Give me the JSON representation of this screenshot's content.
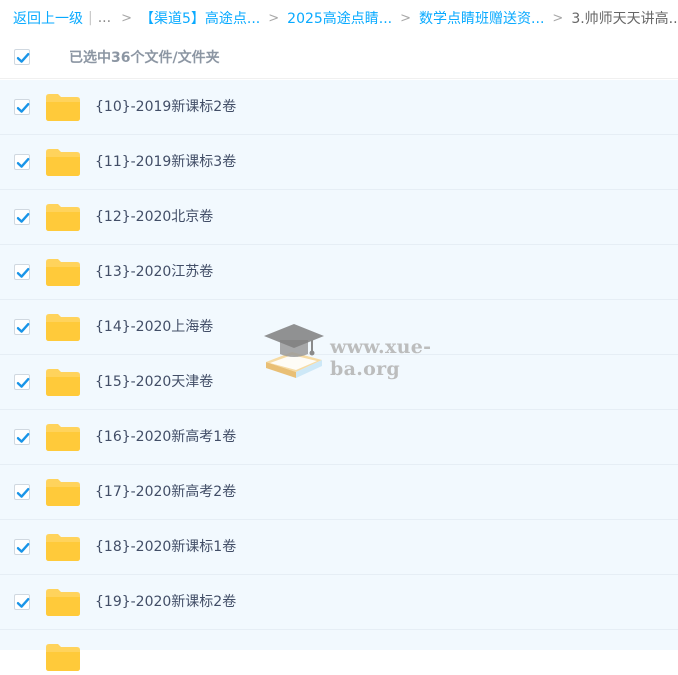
{
  "breadcrumb": {
    "back": "返回上一级",
    "ellipsis": "...",
    "separator": ">",
    "items": [
      "【渠道5】高途点...",
      "2025高途点睛...",
      "数学点睛班赠送资...",
      "3.帅师天天讲高..."
    ]
  },
  "selection": {
    "text": "已选中36个文件/文件夹",
    "checked": true
  },
  "files": [
    {
      "name": "{10}-2019新课标2卷",
      "checked": true
    },
    {
      "name": "{11}-2019新课标3卷",
      "checked": true
    },
    {
      "name": "{12}-2020北京卷",
      "checked": true
    },
    {
      "name": "{13}-2020江苏卷",
      "checked": true
    },
    {
      "name": "{14}-2020上海卷",
      "checked": true
    },
    {
      "name": "{15}-2020天津卷",
      "checked": true
    },
    {
      "name": "{16}-2020新高考1卷",
      "checked": true
    },
    {
      "name": "{17}-2020新高考2卷",
      "checked": true
    },
    {
      "name": "{18}-2020新课标1卷",
      "checked": true
    },
    {
      "name": "{19}-2020新课标2卷",
      "checked": true
    }
  ],
  "watermark": {
    "text": "www.xue-ba.org",
    "icon": "graduation-cap-icon"
  },
  "colors": {
    "link": "#09aaff",
    "check": "#1a95e8",
    "folder": "#ffd35c",
    "row_bg": "#f2f9fe",
    "file_text": "#424e67"
  }
}
